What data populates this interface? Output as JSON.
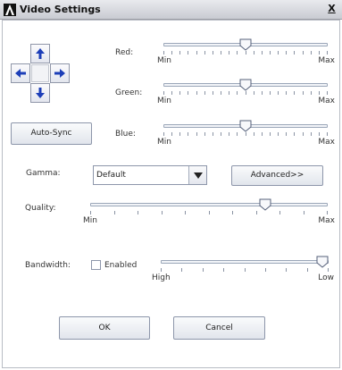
{
  "window": {
    "title": "Video Settings",
    "close_label": "X",
    "logo_icon": "logo-a-icon"
  },
  "direction_pad": {
    "up_icon": "arrow-up-icon",
    "down_icon": "arrow-down-icon",
    "left_icon": "arrow-left-icon",
    "right_icon": "arrow-right-icon",
    "arrow_color": "#1d3fb8"
  },
  "color": {
    "red_label": "Red:",
    "green_label": "Green:",
    "blue_label": "Blue:",
    "min_label": "Min",
    "max_label": "Max",
    "red_level": 0.5,
    "green_level": 0.5,
    "blue_level": 0.5
  },
  "auto_sync_label": "Auto-Sync",
  "gamma": {
    "label": "Gamma:",
    "selected": "Default",
    "advanced_label": "Advanced>>"
  },
  "quality": {
    "label": "Quality:",
    "min_label": "Min",
    "max_label": "Max",
    "level": 0.75
  },
  "bandwidth": {
    "label": "Bandwidth:",
    "enabled_label": "Enabled",
    "enabled": false,
    "high_label": "High",
    "low_label": "Low",
    "level": 1.0
  },
  "actions": {
    "ok_label": "OK",
    "cancel_label": "Cancel"
  }
}
